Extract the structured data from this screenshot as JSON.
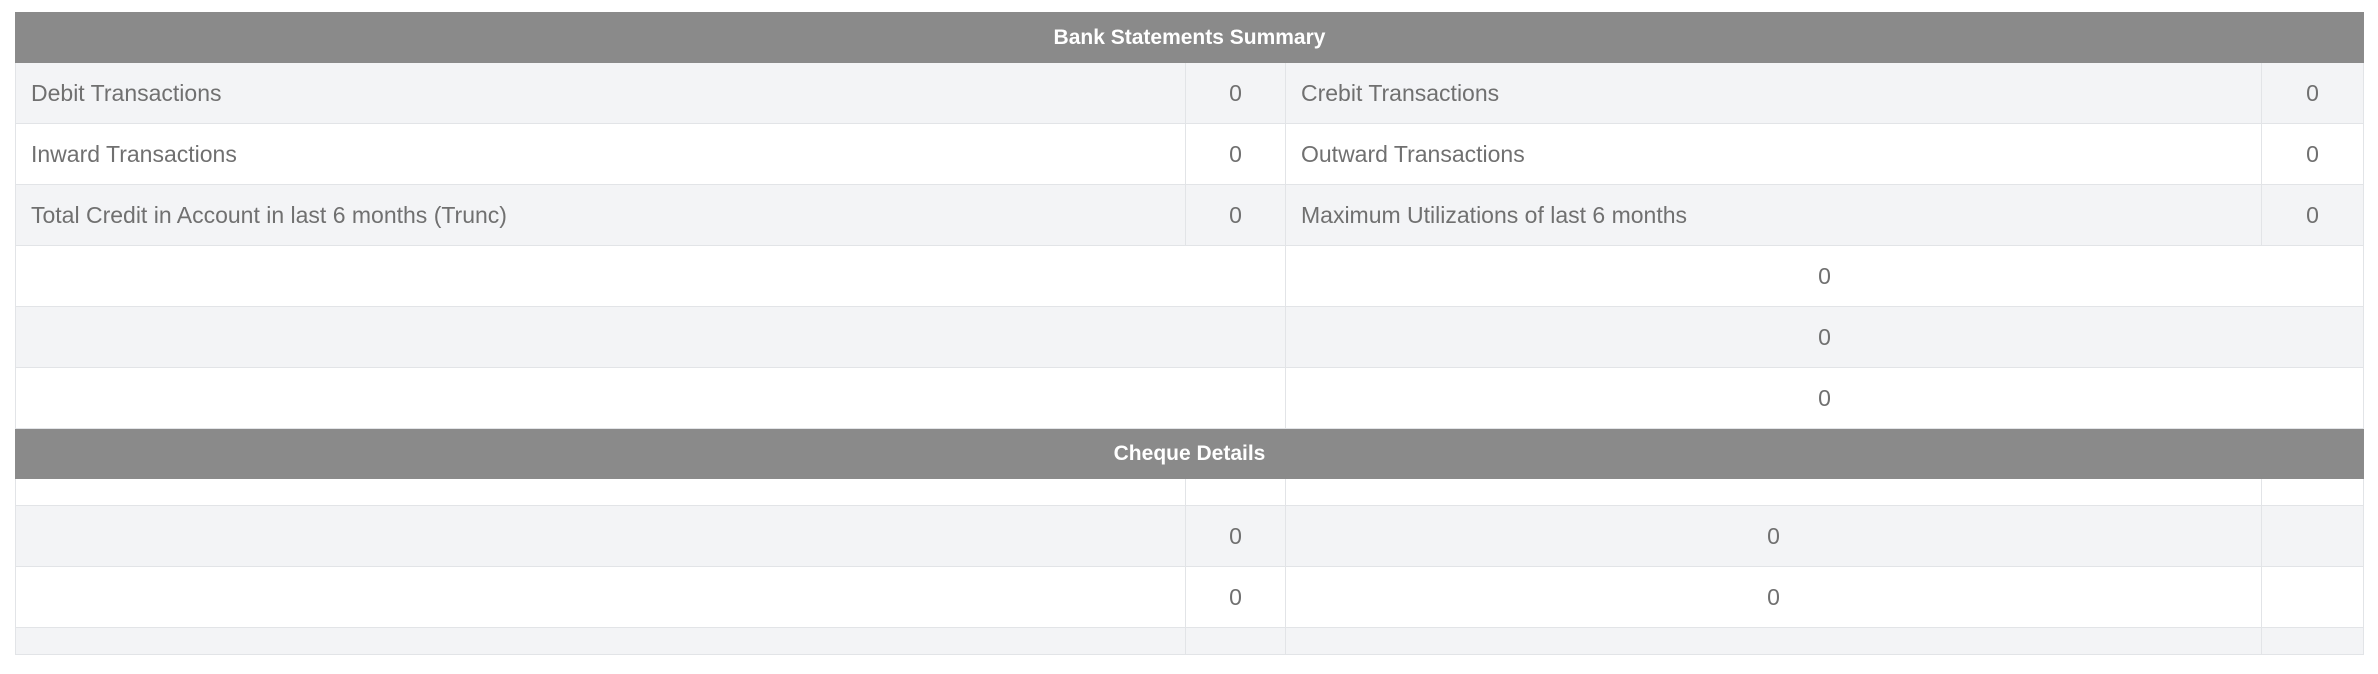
{
  "bank_summary": {
    "title": "Bank Statements Summary",
    "rows": [
      {
        "left_label": "Debit Transactions",
        "left_value": "0",
        "right_label": "Crebit Transactions",
        "right_value": "0"
      },
      {
        "left_label": "Inward Transactions",
        "left_value": "0",
        "right_label": "Outward Transactions",
        "right_value": "0"
      },
      {
        "left_label": "Total Credit in Account in last 6 months (Trunc)",
        "left_value": "0",
        "right_label": "Maximum Utilizations of last 6 months",
        "right_value": "0"
      }
    ],
    "extra_rows": [
      {
        "value": "0"
      },
      {
        "value": "0"
      },
      {
        "value": "0"
      }
    ]
  },
  "cheque_details": {
    "title": "Cheque Details",
    "rows": [
      {
        "col2": "0",
        "col3": "0"
      },
      {
        "col2": "0",
        "col3": "0"
      }
    ]
  }
}
